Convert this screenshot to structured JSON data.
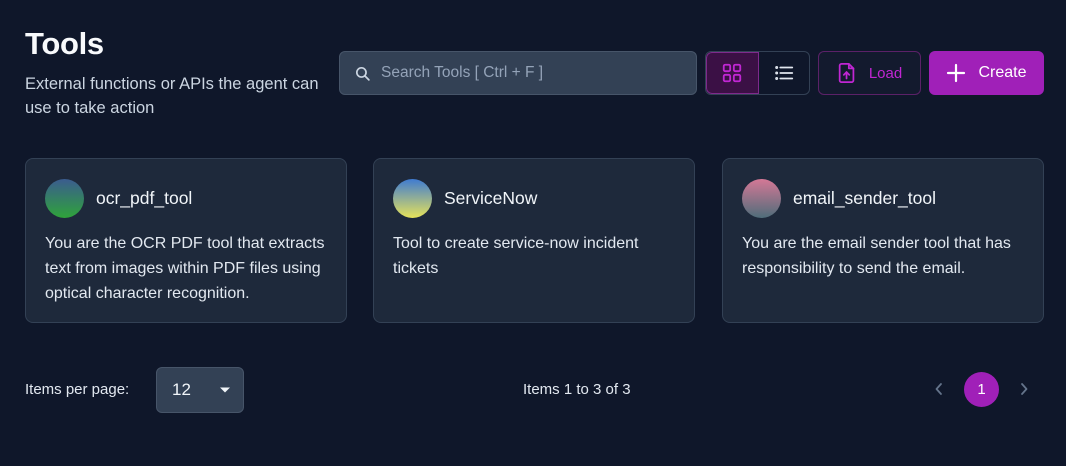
{
  "header": {
    "title": "Tools",
    "subtitle": "External functions or APIs the agent can use to take action"
  },
  "toolbar": {
    "search_placeholder": "Search Tools [ Ctrl + F ]",
    "load_label": "Load",
    "create_label": "Create",
    "view_mode": "grid"
  },
  "cards": [
    {
      "title": "ocr_pdf_tool",
      "description": "You are the OCR PDF tool that extracts text from images within PDF files using optical character recognition.",
      "avatar_top": "#3b5c8f",
      "avatar_bottom": "#2fa33a"
    },
    {
      "title": "ServiceNow",
      "description": "Tool to create service-now incident tickets",
      "avatar_top": "#3f7bd1",
      "avatar_bottom": "#e6e35a"
    },
    {
      "title": "email_sender_tool",
      "description": "You are the email sender tool that has responsibility to send the email.",
      "avatar_top": "#d47896",
      "avatar_bottom": "#4f6d7a"
    }
  ],
  "pagination": {
    "items_per_page_label": "Items per page:",
    "items_per_page_value": "12",
    "range_text": "Items 1 to 3 of 3",
    "current_page": "1"
  },
  "colors": {
    "accent": "#a020b8",
    "background": "#0f172a",
    "card": "#1e293b"
  }
}
